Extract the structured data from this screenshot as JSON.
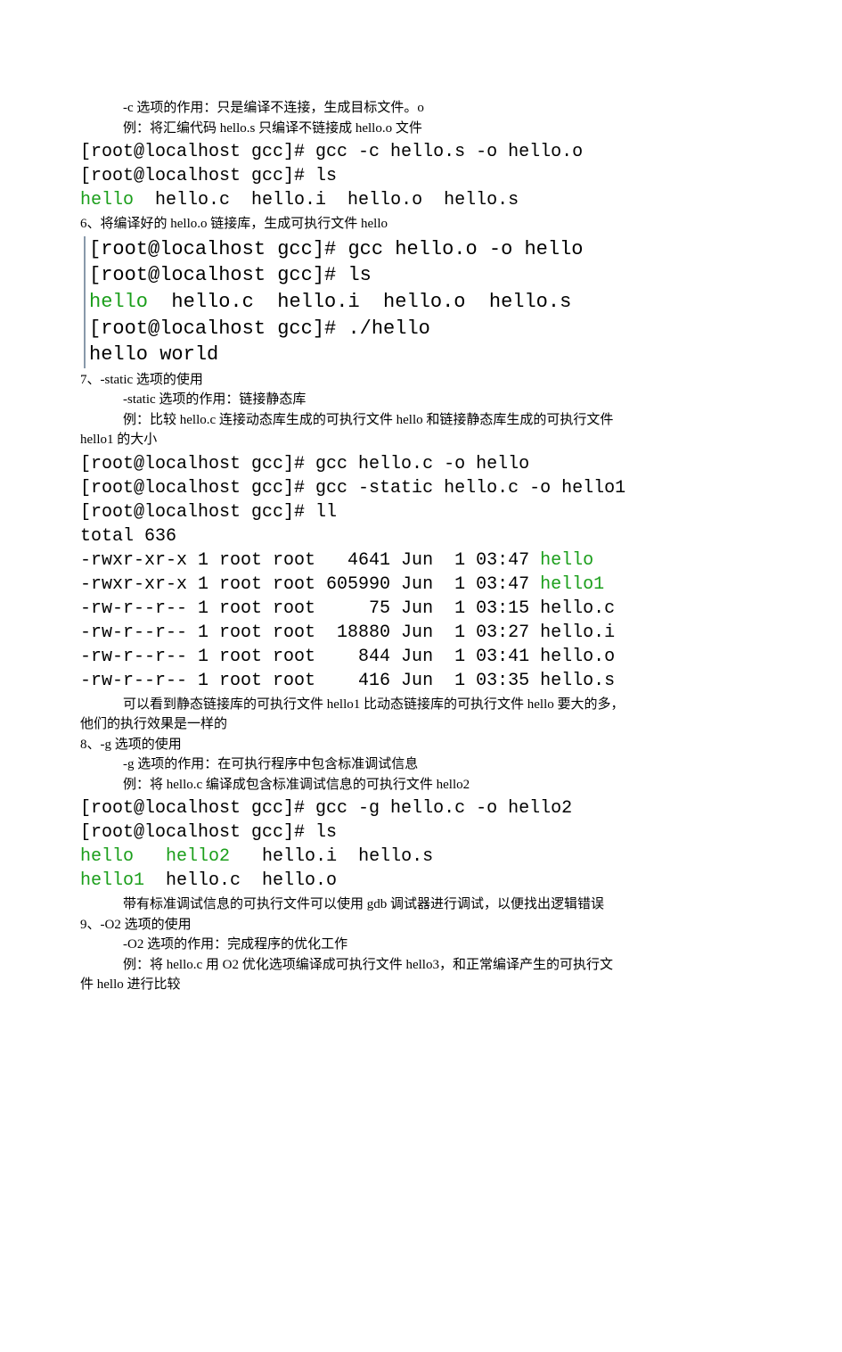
{
  "sec_c": {
    "desc": "-c 选项的作用：只是编译不连接，生成目标文件。o",
    "ex": "例：将汇编代码 hello.s 只编译不链接成 hello.o 文件",
    "term": {
      "l1": "[root@localhost gcc]# gcc -c hello.s -o hello.o",
      "l2": "[root@localhost gcc]# ls",
      "files": {
        "hello": "hello",
        "rest": "  hello.c  hello.i  hello.o  hello.s"
      }
    }
  },
  "sec6": {
    "title": "6、将编译好的 hello.o 链接库，生成可执行文件 hello",
    "term": {
      "l1": "[root@localhost gcc]# gcc hello.o -o hello",
      "l2": "[root@localhost gcc]# ls",
      "files": {
        "hello": "hello",
        "rest": "  hello.c  hello.i  hello.o  hello.s"
      },
      "l4": "[root@localhost gcc]# ./hello",
      "l5": "hello world"
    }
  },
  "sec7": {
    "title": "7、-static 选项的使用",
    "desc": "-static 选项的作用：链接静态库",
    "ex1": "例：比较 hello.c 连接动态库生成的可执行文件 hello 和链接静态库生成的可执行文件",
    "ex2": "hello1 的大小",
    "term": {
      "l1": "[root@localhost gcc]# gcc hello.c -o hello",
      "l2": "[root@localhost gcc]# gcc -static hello.c -o hello1",
      "l3": "[root@localhost gcc]# ll",
      "l4": "total 636",
      "r1a": "-rwxr-xr-x 1 root root   4641 Jun  1 03:47 ",
      "r1b": "hello",
      "r2a": "-rwxr-xr-x 1 root root 605990 Jun  1 03:47 ",
      "r2b": "hello1",
      "r3": "-rw-r--r-- 1 root root     75 Jun  1 03:15 hello.c",
      "r4": "-rw-r--r-- 1 root root  18880 Jun  1 03:27 hello.i",
      "r5": "-rw-r--r-- 1 root root    844 Jun  1 03:41 hello.o",
      "r6": "-rw-r--r-- 1 root root    416 Jun  1 03:35 hello.s"
    },
    "note1": "可以看到静态链接库的可执行文件 hello1 比动态链接库的可执行文件 hello 要大的多，",
    "note2": "他们的执行效果是一样的"
  },
  "sec8": {
    "title": "8、-g 选项的使用",
    "desc": "-g 选项的作用：在可执行程序中包含标准调试信息",
    "ex": "例：将 hello.c 编译成包含标准调试信息的可执行文件 hello2",
    "term": {
      "l1": "[root@localhost gcc]# gcc -g hello.c -o hello2",
      "l2": "[root@localhost gcc]# ls",
      "row1": {
        "a": "hello",
        "b": "   ",
        "c": "hello2",
        "d": "   hello.i  hello.s"
      },
      "row2": {
        "a": "hello1",
        "b": "  hello.c  hello.o"
      }
    },
    "note": "带有标准调试信息的可执行文件可以使用 gdb 调试器进行调试，以便找出逻辑错误"
  },
  "sec9": {
    "title": "9、-O2 选项的使用",
    "desc": "-O2 选项的作用：完成程序的优化工作",
    "ex1": "例：将 hello.c 用 O2 优化选项编译成可执行文件 hello3，和正常编译产生的可执行文",
    "ex2": "件 hello 进行比较"
  }
}
